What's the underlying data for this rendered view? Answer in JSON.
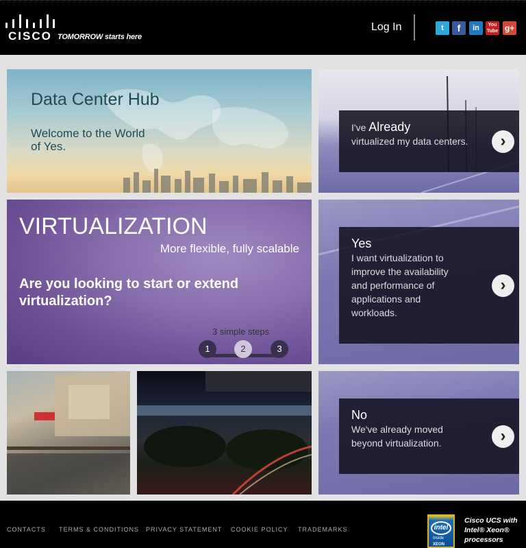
{
  "header": {
    "logo_text": "CISCO",
    "tagline": "TOMORROW starts here",
    "login_label": "Log In",
    "social": [
      {
        "name": "twitter-icon",
        "glyph": "t"
      },
      {
        "name": "facebook-icon",
        "glyph": "f"
      },
      {
        "name": "linkedin-icon",
        "glyph": "in"
      },
      {
        "name": "youtube-icon",
        "glyph": "You\nTube"
      },
      {
        "name": "googleplus-icon",
        "glyph": "g+"
      }
    ]
  },
  "hub": {
    "title": "Data Center Hub",
    "subtitle": "Welcome to the World of Yes."
  },
  "virtualization": {
    "heading": "VIRTUALIZATION",
    "tagline": "More flexible, fully scalable",
    "question": "Are you looking to start or extend virtualization?",
    "steps_label": "3 simple steps",
    "steps": [
      "1",
      "2",
      "3"
    ],
    "active_step": 2
  },
  "cards": {
    "already": {
      "prefix": "I've ",
      "heading": "Already",
      "body": "virtualized my data centers."
    },
    "yes": {
      "heading": "Yes",
      "body": "I want virtualization to improve the availability and performance of applications and workloads."
    },
    "no": {
      "heading": "No",
      "body": "We've already moved beyond virtualization."
    }
  },
  "footer": {
    "links": [
      "CONTACTS",
      "TERMS & CONDITIONS",
      "PRIVACY STATEMENT",
      "COOKIE POLICY",
      "TRADEMARKS"
    ],
    "intel_logo": "intel",
    "intel_inside": "Inside",
    "intel_xeon": "XEON",
    "ucs_text": "Cisco UCS with Intel® Xeon® processors"
  },
  "colors": {
    "virt_purple": "#6d4f95",
    "panel_dark": "#12101e",
    "road_lavender": "#7b78b1",
    "background_grey": "#e2e2e2"
  }
}
